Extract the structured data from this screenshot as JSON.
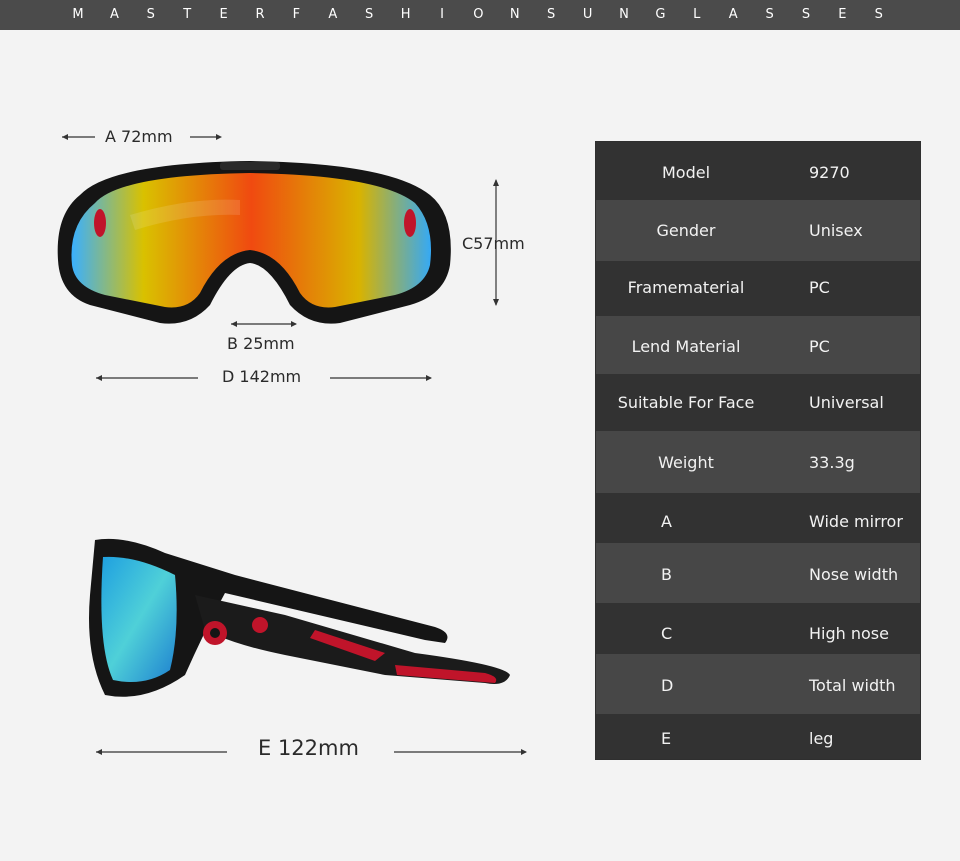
{
  "brand": {
    "letters": [
      "M",
      "A",
      "S",
      "T",
      "E",
      "R",
      "F",
      "A",
      "S",
      "H",
      "I",
      "O",
      "N",
      "S",
      "U",
      "N",
      "G",
      "L",
      "A",
      "S",
      "S",
      "E",
      "S"
    ]
  },
  "dimensions": {
    "a": "A 72mm",
    "b": "B 25mm",
    "c": "C57mm",
    "d": "D 142mm",
    "e": "E 122mm"
  },
  "specs": [
    {
      "key": "Model",
      "value": "9270"
    },
    {
      "key": "Gender",
      "value": "Unisex"
    },
    {
      "key": "Framematerial",
      "value": "PC"
    },
    {
      "key": "Lend Material",
      "value": "PC"
    },
    {
      "key": "Suitable For Face",
      "value": "Universal"
    },
    {
      "key": "Weight",
      "value": "33.3g"
    },
    {
      "key": "A",
      "value": "Wide mirror"
    },
    {
      "key": "B",
      "value": "Nose width"
    },
    {
      "key": "C",
      "value": "High nose"
    },
    {
      "key": "D",
      "value": "Total width"
    },
    {
      "key": "E",
      "value": "leg"
    }
  ],
  "colors": {
    "header_bg": "#4b4b4b",
    "spec_dark": "#323232",
    "spec_light": "#474747",
    "frame": "#1a1a1a",
    "accent_red": "#c0142a"
  },
  "icons": [
    "front-sunglasses-image",
    "side-sunglasses-image"
  ]
}
